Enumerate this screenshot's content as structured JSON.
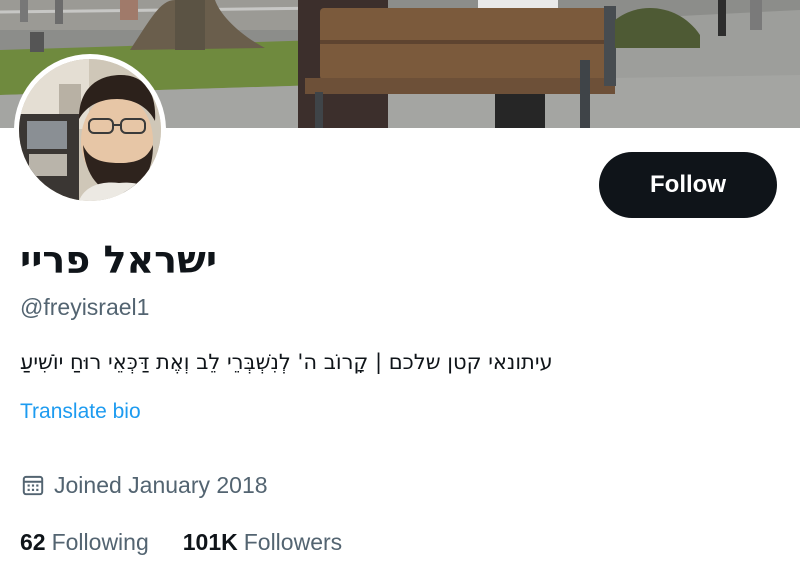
{
  "profile": {
    "display_name": "ישראל פריי",
    "handle": "@freyisrael1",
    "bio": "עיתונאי קטן שלכם | קָרוֹב ה' לְנִשְׁבְּרֵי לֵב וְאֶת דַּכְּאֵי רוּחַ יוֹשִׁיעַ",
    "translate_label": "Translate bio",
    "joined": "Joined January 2018"
  },
  "actions": {
    "follow_label": "Follow"
  },
  "stats": {
    "following_count": "62",
    "following_label": "Following",
    "followers_count": "101K",
    "followers_label": "Followers"
  },
  "colors": {
    "primary_text": "#0f1419",
    "secondary_text": "#536471",
    "link": "#1d9bf0",
    "button_bg": "#0f1419"
  },
  "icons": {
    "joined": "calendar-icon"
  }
}
